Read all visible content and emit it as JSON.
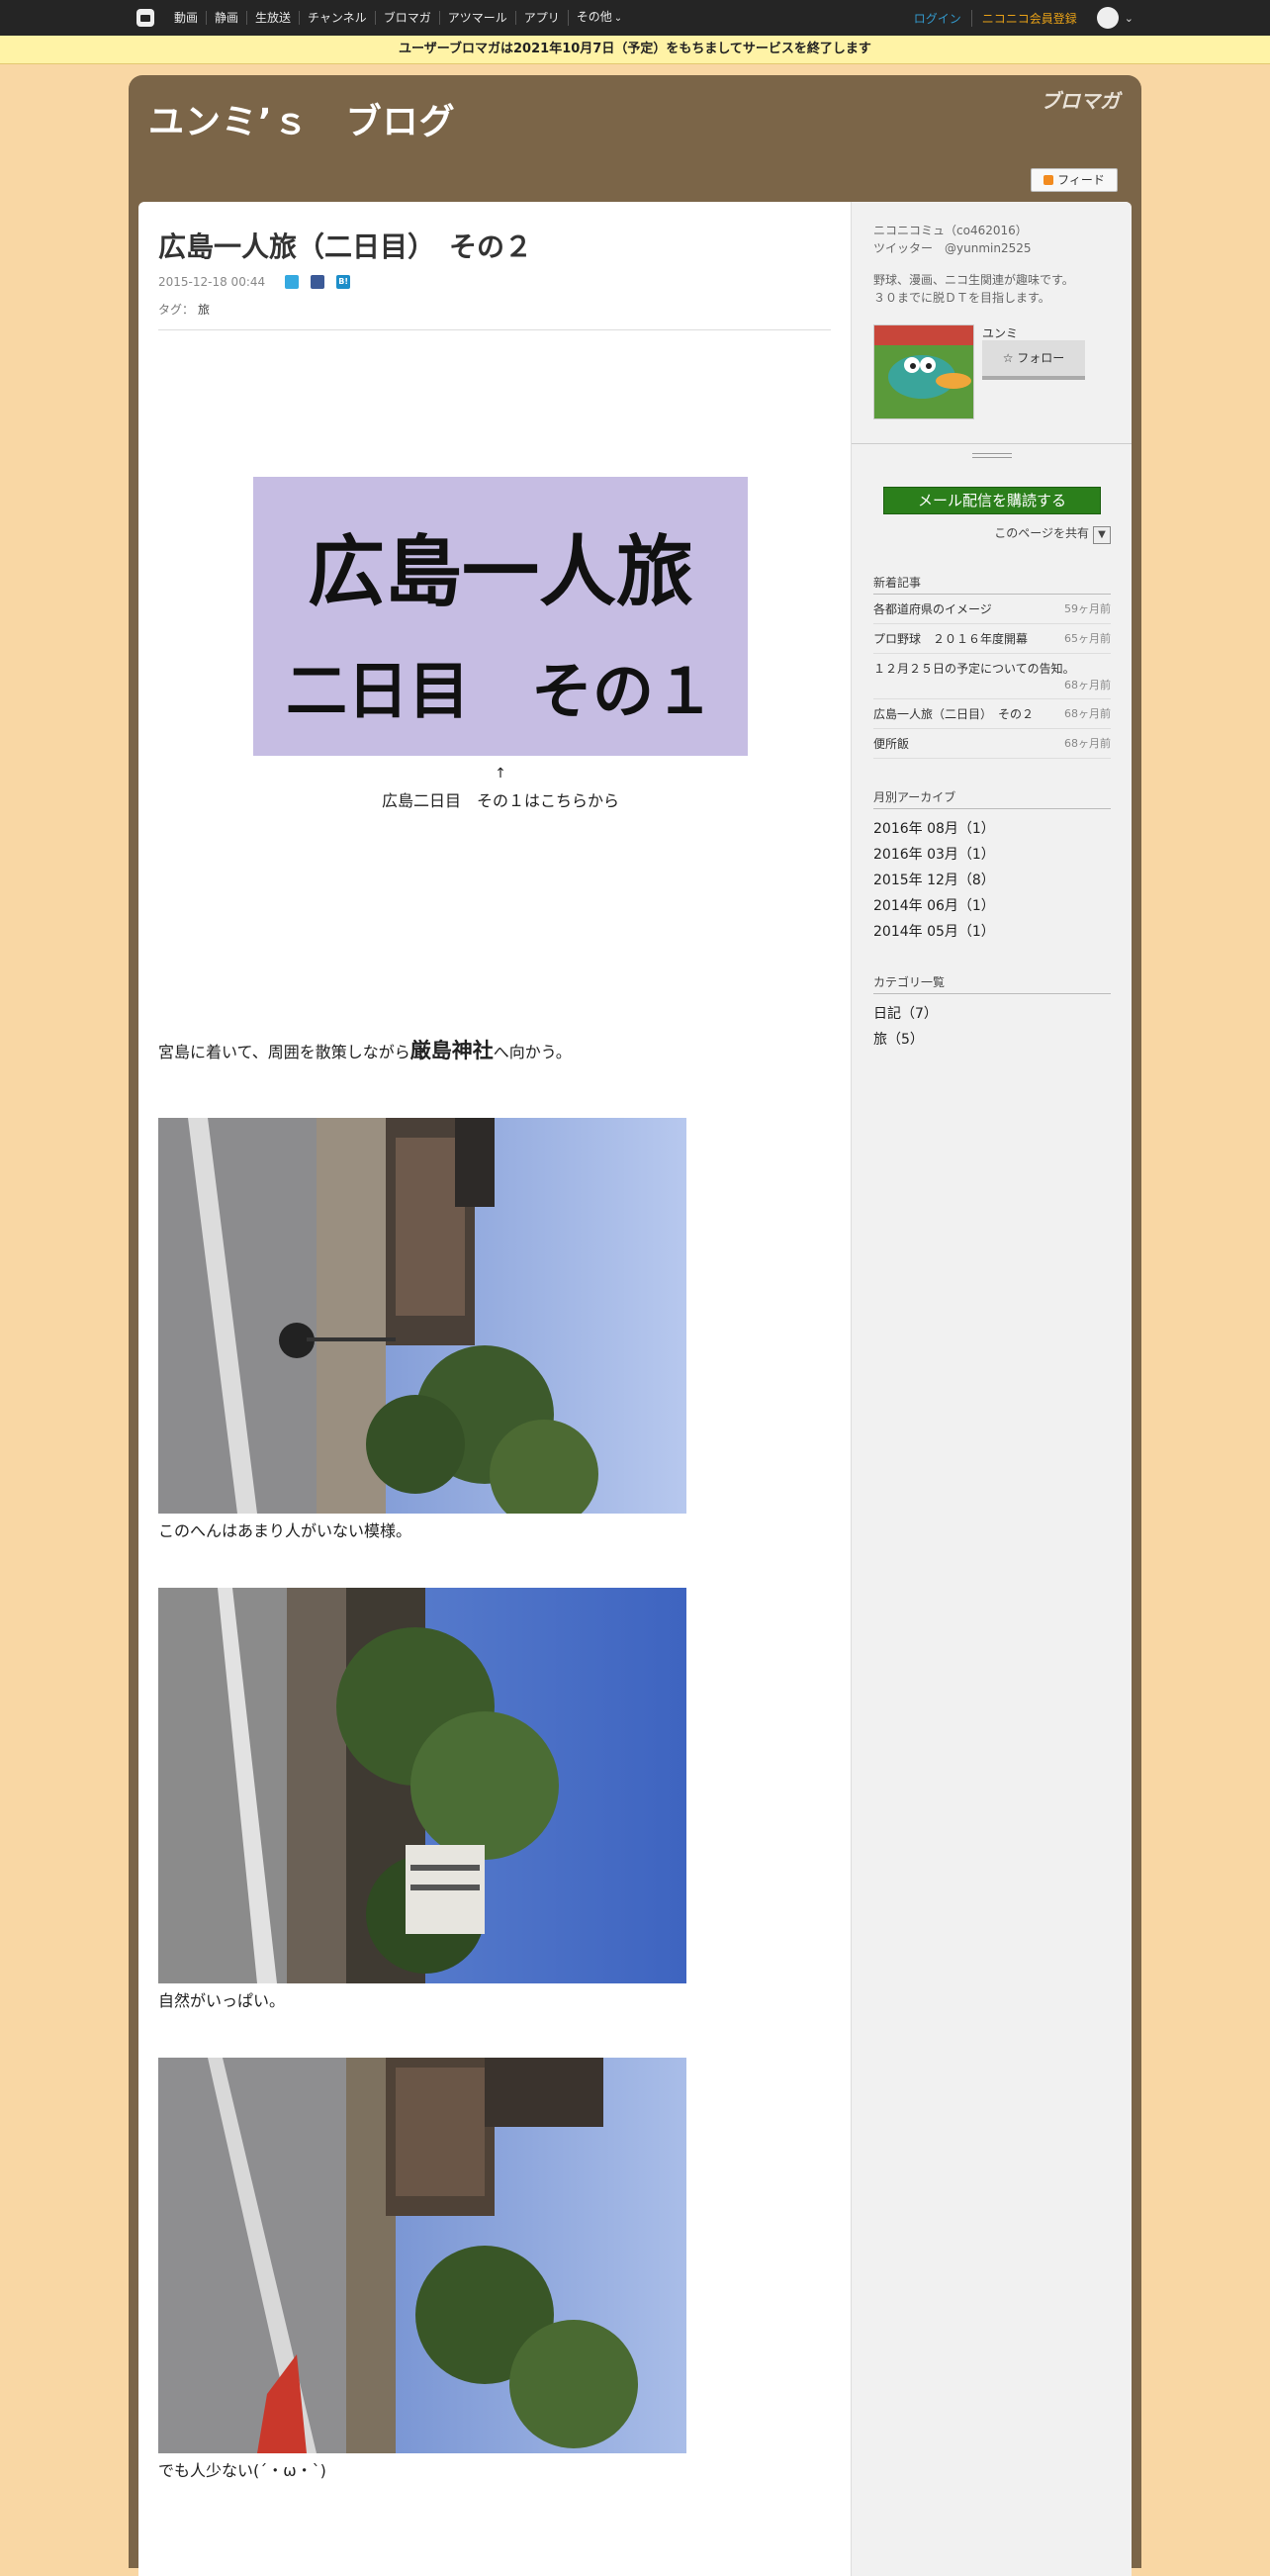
{
  "topbar": {
    "nav": [
      "動画",
      "静画",
      "生放送",
      "チャンネル",
      "ブロマガ",
      "アツマール",
      "アプリ",
      "その他"
    ],
    "login": "ログイン",
    "register": "ニコニコ会員登録"
  },
  "notice": "ユーザーブロマガは2021年10月7日（予定）をもちましてサービスを終了します",
  "blog": {
    "title": "ユンミ’ｓ　ブログ",
    "logo": "ブロマガ",
    "feed": "フィード"
  },
  "post": {
    "title": "広島一人旅（二日目）　その２",
    "date": "2015-12-18 00:44",
    "tags_label": "タグ：",
    "tag": "旅",
    "banner_line1": "広島一人旅",
    "banner_line2": "二日目　その１",
    "arrow": "↑",
    "link_text": "広島二日目　その１はこちらから",
    "para_before": "宮島に着いて、周囲を散策しながら",
    "para_em": "厳島神社",
    "para_after": "へ向かう。",
    "captions": [
      "このへんはあまり人がいない模様。",
      "自然がいっぱい。",
      "でも人少ない(´・ω・`)"
    ]
  },
  "sidebar": {
    "community": "ニコニコミュ（co462016）",
    "twitter": "ツイッター　@yunmin2525",
    "bio1": "野球、漫画、ニコ生関連が趣味です。",
    "bio2": "３０までに脱ＤＴを目指します。",
    "user_name": "ユンミ",
    "follow": "フォロー",
    "mail": "メール配信を購読する",
    "share": "このページを共有",
    "recent_title": "新着記事",
    "recent": [
      {
        "title": "各都道府県のイメージ",
        "age": "59ヶ月前"
      },
      {
        "title": "プロ野球　２０１６年度開幕",
        "age": "65ヶ月前"
      },
      {
        "title": "１２月２５日の予定についての告知。",
        "age": "68ヶ月前"
      },
      {
        "title": "広島一人旅（二日目）　その２",
        "age": "68ヶ月前"
      },
      {
        "title": "便所飯",
        "age": "68ヶ月前"
      }
    ],
    "archive_title": "月別アーカイブ",
    "archive": [
      "2016年 08月（1）",
      "2016年 03月（1）",
      "2015年 12月（8）",
      "2014年 06月（1）",
      "2014年 05月（1）"
    ],
    "category_title": "カテゴリ一覧",
    "categories": [
      "日記（7）",
      "旅（5）"
    ]
  },
  "colors": {
    "page_bg": "#f9d7a4",
    "frame": "#7b6548",
    "banner": "#c6bde3",
    "mail_button": "#2b7f1b"
  }
}
